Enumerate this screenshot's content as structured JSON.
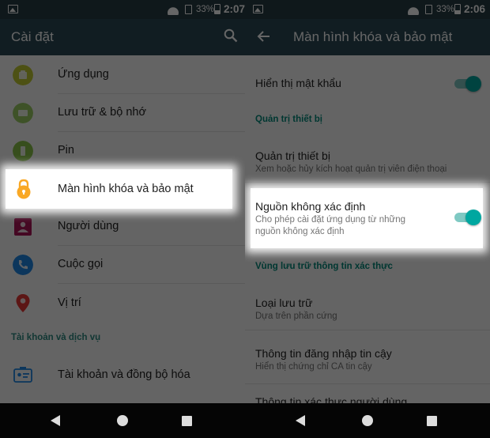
{
  "left_screen": {
    "status_bar": {
      "battery_percent": "33%",
      "time": "2:07"
    },
    "app_bar": {
      "title": "Cài đặt"
    },
    "items": [
      {
        "label": "Ứng dụng",
        "icon": "apps-icon",
        "icon_color": "#c0ca33"
      },
      {
        "label": "Lưu trữ & bộ nhớ",
        "icon": "storage-icon",
        "icon_color": "#9ccc65"
      },
      {
        "label": "Pin",
        "icon": "battery-icon",
        "icon_color": "#8bc34a"
      },
      {
        "label": "Màn hình khóa và bảo mật",
        "icon": "lock-icon",
        "icon_color": "#f9a825",
        "highlighted": true
      },
      {
        "label": "Người dùng",
        "icon": "users-icon",
        "icon_color": "#ad1457"
      },
      {
        "label": "Cuộc gọi",
        "icon": "phone-icon",
        "icon_color": "#1e88e5"
      },
      {
        "label": "Vị trí",
        "icon": "location-icon",
        "icon_color": "#e53935"
      }
    ],
    "section_header": "Tài khoản và dịch vụ",
    "account_item": {
      "label": "Tài khoản và đồng bộ hóa",
      "icon": "account-card-icon"
    }
  },
  "right_screen": {
    "status_bar": {
      "battery_percent": "33%",
      "time": "2:06"
    },
    "app_bar": {
      "title": "Màn hình khóa và bảo mật"
    },
    "show_password": {
      "label": "Hiển thị mật khẩu",
      "enabled": true
    },
    "device_admin_header": "Quản trị thiết bị",
    "device_admin": {
      "title": "Quản trị thiết bị",
      "subtitle": "Xem hoặc hủy kích hoạt quản trị viên điện thoại"
    },
    "unknown_sources": {
      "title": "Nguồn không xác định",
      "subtitle": "Cho phép cài đặt ứng dụng từ những nguồn không xác định",
      "enabled": true,
      "highlighted": true
    },
    "credential_header": "Vùng lưu trữ thông tin xác thực",
    "storage_type": {
      "title": "Loại lưu trữ",
      "subtitle": "Dựa trên phần cứng"
    },
    "trusted_credentials": {
      "title": "Thông tin đăng nhập tin cậy",
      "subtitle": "Hiển thị chứng chỉ CA tin cậy"
    },
    "partial_item": {
      "title": "Thông tin xác thực người dùng"
    }
  },
  "colors": {
    "status_bar": "#263c44",
    "app_bar": "#2b4a56",
    "accent": "#00a7a0",
    "section_header": "#00897b"
  }
}
